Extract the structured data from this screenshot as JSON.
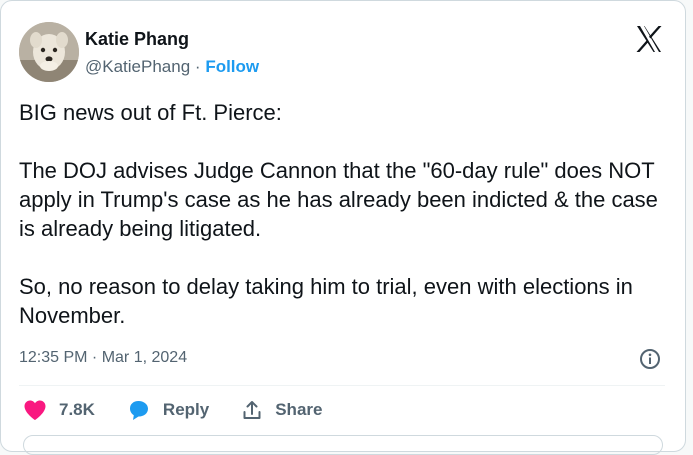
{
  "author": {
    "name": "Katie Phang",
    "handle": "@KatiePhang",
    "separator": "·",
    "follow_label": "Follow"
  },
  "tweet": {
    "text": "BIG news out of Ft. Pierce:\n\nThe DOJ advises Judge Cannon that the \"60-day rule\" does NOT apply in Trump's case as he has already been indicted & the case is already being litigated.\n\nSo, no reason to delay taking him to trial, even with elections in November.",
    "timestamp": "12:35 PM · Mar 1, 2024"
  },
  "actions": {
    "like_count": "7.8K",
    "reply_label": "Reply",
    "share_label": "Share"
  },
  "icons": {
    "logo": "x-logo-icon",
    "info": "info-icon",
    "like": "heart-icon",
    "reply": "speech-bubble-icon",
    "share": "share-upload-icon"
  },
  "colors": {
    "like": "#f91880",
    "reply": "#1d9bf0",
    "follow": "#1d9bf0",
    "text": "#0f1419",
    "muted": "#536471"
  }
}
